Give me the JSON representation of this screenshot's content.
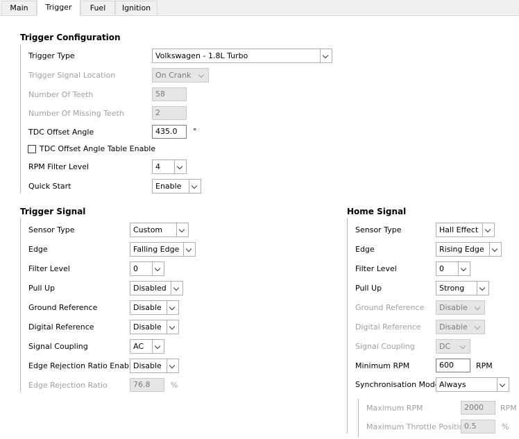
{
  "tabs": [
    "Main",
    "Trigger",
    "Fuel",
    "Ignition"
  ],
  "trigger_config": {
    "title": "Trigger Configuration",
    "trigger_type": {
      "label": "Trigger Type",
      "value": "Volkswagen - 1.8L Turbo"
    },
    "signal_location": {
      "label": "Trigger Signal Location",
      "value": "On Crank"
    },
    "num_teeth": {
      "label": "Number Of Teeth",
      "value": "58"
    },
    "missing_teeth": {
      "label": "Number Of Missing Teeth",
      "value": "2"
    },
    "tdc_offset": {
      "label": "TDC Offset Angle",
      "value": "435.0",
      "unit": "°"
    },
    "tdc_table_enable": {
      "label": "TDC Offset Angle Table Enable",
      "checked": false
    },
    "rpm_filter": {
      "label": "RPM Filter Level",
      "value": "4"
    },
    "quick_start": {
      "label": "Quick Start",
      "value": "Enable"
    }
  },
  "trigger_signal": {
    "title": "Trigger Signal",
    "sensor_type": {
      "label": "Sensor Type",
      "value": "Custom"
    },
    "edge": {
      "label": "Edge",
      "value": "Falling Edge"
    },
    "filter_level": {
      "label": "Filter Level",
      "value": "0"
    },
    "pull_up": {
      "label": "Pull Up",
      "value": "Disabled"
    },
    "ground_ref": {
      "label": "Ground Reference",
      "value": "Disable"
    },
    "digital_ref": {
      "label": "Digital Reference",
      "value": "Disable"
    },
    "coupling": {
      "label": "Signal Coupling",
      "value": "AC"
    },
    "edge_rej_enable": {
      "label": "Edge Rejection Ratio Enable",
      "value": "Disable"
    },
    "edge_rej_ratio": {
      "label": "Edge Rejection Ratio",
      "value": "76.8",
      "unit": "%"
    }
  },
  "home_signal": {
    "title": "Home Signal",
    "sensor_type": {
      "label": "Sensor Type",
      "value": "Hall Effect"
    },
    "edge": {
      "label": "Edge",
      "value": "Rising Edge"
    },
    "filter_level": {
      "label": "Filter Level",
      "value": "0"
    },
    "pull_up": {
      "label": "Pull Up",
      "value": "Strong"
    },
    "ground_ref": {
      "label": "Ground Reference",
      "value": "Disable"
    },
    "digital_ref": {
      "label": "Digital Reference",
      "value": "Disable"
    },
    "coupling": {
      "label": "Signal Coupling",
      "value": "DC"
    },
    "min_rpm": {
      "label": "Minimum RPM",
      "value": "600",
      "unit": "RPM"
    },
    "sync_mode": {
      "label": "Synchronisation Mode",
      "value": "Always"
    },
    "max_rpm": {
      "label": "Maximum RPM",
      "value": "2000",
      "unit": "RPM"
    },
    "max_throttle": {
      "label": "Maximum Throttle Position",
      "value": "0.5",
      "unit": "%"
    }
  }
}
